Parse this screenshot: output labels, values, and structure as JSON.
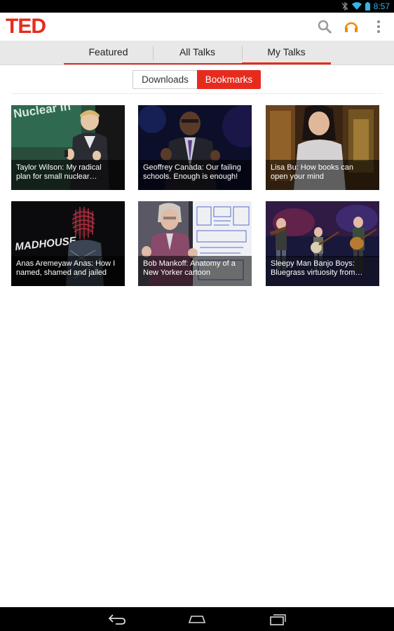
{
  "status_bar": {
    "time": "8:57",
    "icons": [
      "bluetooth-off-icon",
      "wifi-icon",
      "battery-icon"
    ]
  },
  "app": {
    "logo": "TED",
    "actions": [
      "search-icon",
      "headphones-icon",
      "overflow-menu-icon"
    ]
  },
  "tabs": [
    {
      "label": "Featured",
      "active": false
    },
    {
      "label": "All Talks",
      "active": false
    },
    {
      "label": "My Talks",
      "active": true
    }
  ],
  "segments": {
    "downloads": "Downloads",
    "bookmarks": "Bookmarks",
    "selected": "Bookmarks"
  },
  "talks": [
    {
      "caption_line1": "Taylor Wilson: My radical",
      "caption_line2": "plan for small nuclear…"
    },
    {
      "caption_line1": "Geoffrey Canada: Our failing",
      "caption_line2": "schools. Enough is enough!"
    },
    {
      "caption_line1": "Lisa Bu: How books can",
      "caption_line2": "open your mind"
    },
    {
      "caption_line1": "Anas Aremeyaw Anas: How I",
      "caption_line2": "named, shamed and jailed"
    },
    {
      "caption_line1": "Bob Mankoff: Anatomy of a",
      "caption_line2": "New Yorker cartoon"
    },
    {
      "caption_line1": "Sleepy Man Banjo Boys:",
      "caption_line2": "Bluegrass virtuosity from…"
    }
  ],
  "thumbnail_text": {
    "talk0_slide": "Nuclear In",
    "talk3_slide": "MADHOUSE"
  },
  "nav": [
    "back-icon",
    "home-icon",
    "recent-apps-icon"
  ],
  "colors": {
    "ted_red": "#e62b1e",
    "status_blue": "#33b5e5",
    "headphones_orange": "#f08a00"
  }
}
